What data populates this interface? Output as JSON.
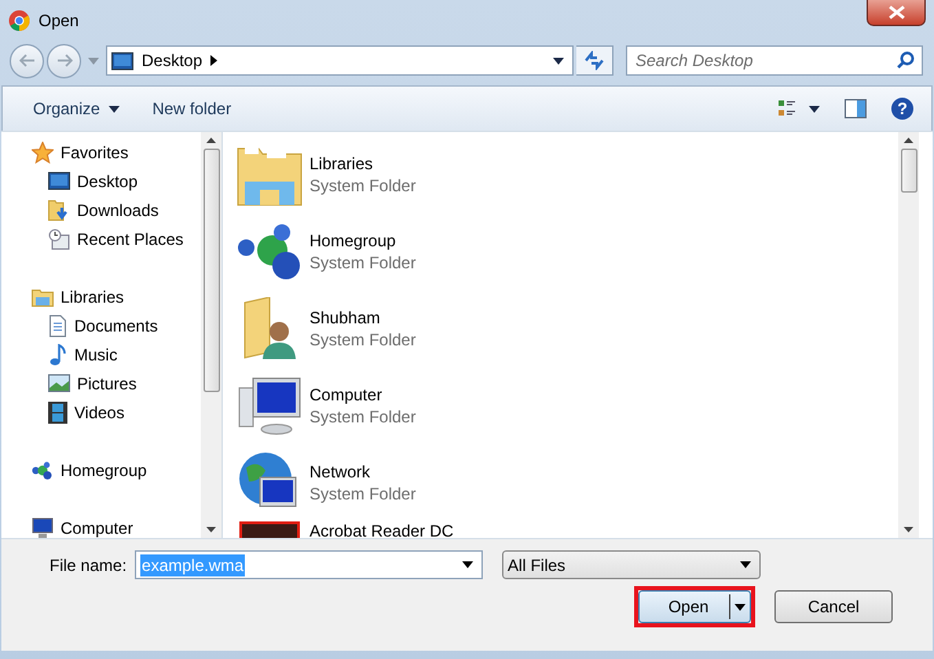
{
  "window": {
    "title": "Open"
  },
  "address_bar": {
    "location": "Desktop",
    "search_placeholder": "Search Desktop"
  },
  "toolbar": {
    "organize": "Organize",
    "new_folder": "New folder",
    "help": "?"
  },
  "sidebar": {
    "groups": [
      {
        "label": "Favorites",
        "children": [
          {
            "label": "Desktop"
          },
          {
            "label": "Downloads"
          },
          {
            "label": "Recent Places"
          }
        ]
      },
      {
        "label": "Libraries",
        "children": [
          {
            "label": "Documents"
          },
          {
            "label": "Music"
          },
          {
            "label": "Pictures"
          },
          {
            "label": "Videos"
          }
        ]
      },
      {
        "label": "Homegroup"
      },
      {
        "label": "Computer"
      }
    ]
  },
  "files": [
    {
      "name": "Libraries",
      "type": "System Folder"
    },
    {
      "name": "Homegroup",
      "type": "System Folder"
    },
    {
      "name": "Shubham",
      "type": "System Folder"
    },
    {
      "name": "Computer",
      "type": "System Folder"
    },
    {
      "name": "Network",
      "type": "System Folder"
    },
    {
      "name": "Acrobat Reader DC"
    }
  ],
  "footer": {
    "file_name_label": "File name:",
    "file_name": "example.wma",
    "file_name_selected": true,
    "file_type": "All Files",
    "buttons": [
      {
        "label": "Open",
        "kind": "split",
        "highlighted": true
      },
      {
        "label": "Cancel",
        "kind": "plain",
        "highlighted": false
      }
    ]
  }
}
